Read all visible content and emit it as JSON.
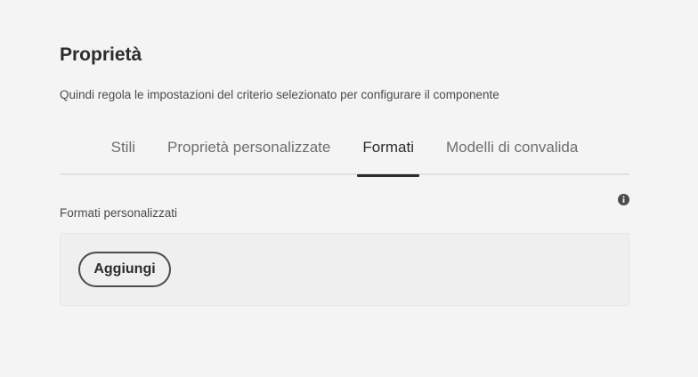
{
  "section": {
    "title": "Proprietà",
    "description": "Quindi regola le impostazioni del criterio selezionato per configurare il componente"
  },
  "tabs": [
    {
      "label": "Stili",
      "selected": false
    },
    {
      "label": "Proprietà personalizzate",
      "selected": false
    },
    {
      "label": "Formati",
      "selected": true
    },
    {
      "label": "Modelli di convalida",
      "selected": false
    }
  ],
  "formats": {
    "label": "Formati personalizzati",
    "info_icon": "info-circle-icon",
    "add_button_label": "Aggiungi"
  },
  "colors": {
    "background": "#f4f4f4",
    "text": "#2c2c2c",
    "muted_text": "#6e6e6e",
    "field_background": "#efefef"
  }
}
